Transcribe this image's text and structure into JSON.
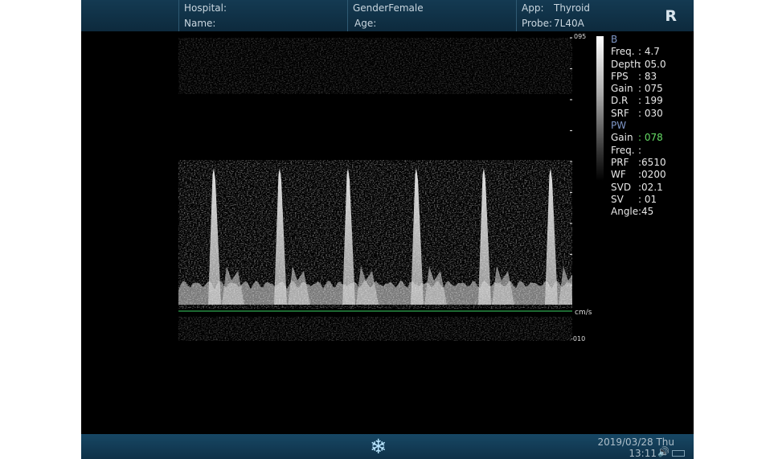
{
  "header": {
    "hospital_label": "Hospital:",
    "name_label": "Name:",
    "gender_label": "GenderFemale",
    "age_label": "Age:",
    "app_label": "App:",
    "app_value": "Thyroid",
    "probe_label": "Probe:",
    "probe_value": "7L40A",
    "orientation": "R"
  },
  "scale": {
    "top": "095",
    "unit": "cm/s",
    "bottom": "-010"
  },
  "params": {
    "b_title": "B",
    "b": [
      {
        "key": "Freq.",
        "value": ": 4.7"
      },
      {
        "key": "Depth",
        "value": ": 05.0"
      },
      {
        "key": "FPS",
        "value": ": 83"
      },
      {
        "key": "Gain",
        "value": ": 075"
      },
      {
        "key": "D.R",
        "value": ": 199"
      },
      {
        "key": "SRF",
        "value": ": 030"
      }
    ],
    "pw_title": "PW",
    "pw": [
      {
        "key": "Gain",
        "value": ": 078",
        "color": "#66dd66"
      },
      {
        "key": "Freq.",
        "value": ":"
      },
      {
        "key": "PRF",
        "value": ":6510"
      },
      {
        "key": "WF",
        "value": ":0200"
      },
      {
        "key": "SVD",
        "value": ":02.1"
      },
      {
        "key": "SV",
        "value": ": 01"
      },
      {
        "key": "Angle",
        "value": ":45"
      }
    ]
  },
  "footer": {
    "date": "2019/03/28 Thu",
    "time": "13:11",
    "freeze_icon": "snowflake-icon",
    "volume_icon": "speaker-icon",
    "battery_icon": "battery-icon"
  },
  "colors": {
    "header_bg": "#143a52",
    "baseline": "#2fa84f",
    "pw_gain": "#66dd66",
    "section_title": "#7f97c7"
  }
}
